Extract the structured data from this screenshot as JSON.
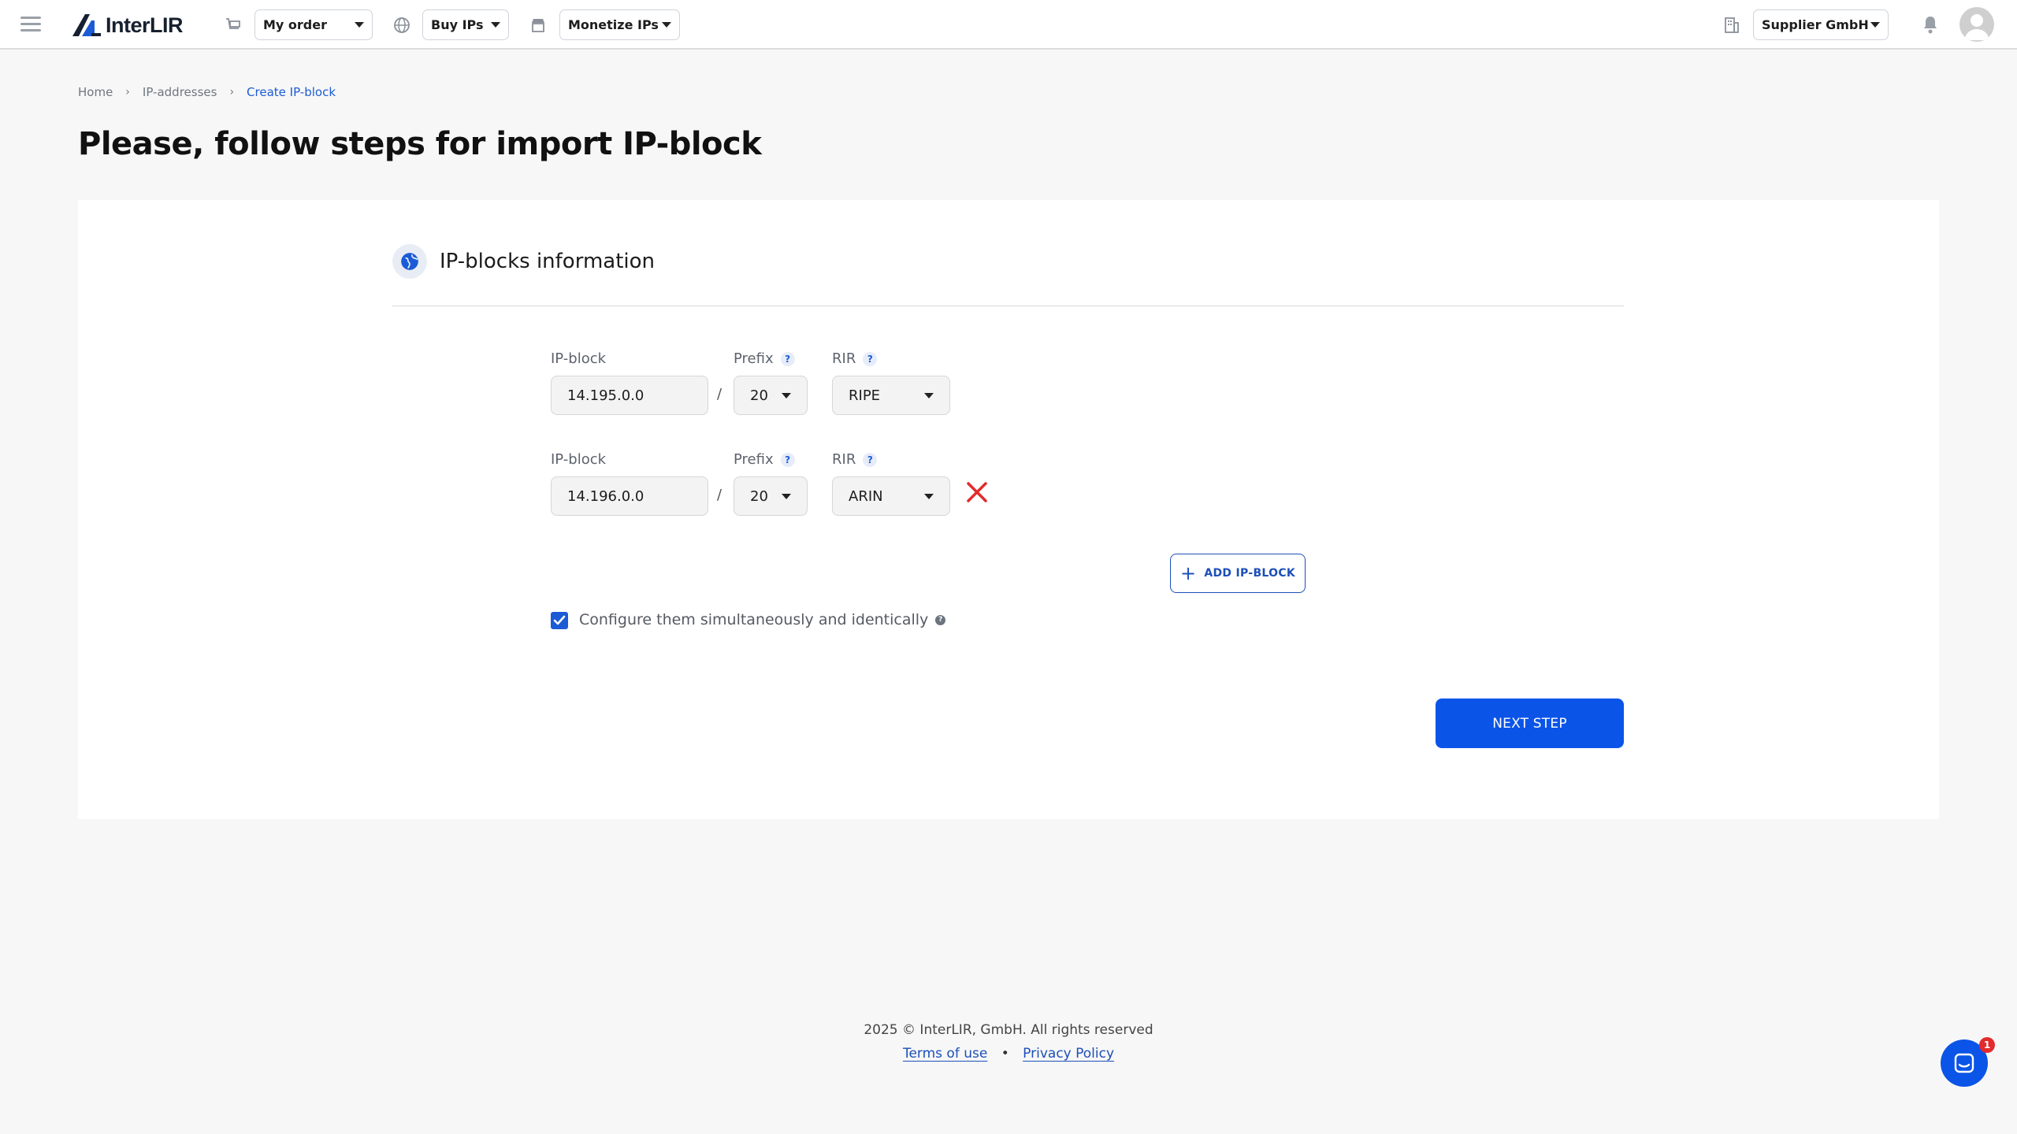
{
  "app": {
    "brand": "InterLIR"
  },
  "nav": {
    "my_order": "My order",
    "buy_ips": "Buy IPs",
    "monetize_ips": "Monetize IPs",
    "company": "Supplier GmbH"
  },
  "breadcrumb": [
    "Home",
    "IP-addresses",
    "Create IP-block"
  ],
  "page_title": "Please, follow steps for import IP-block",
  "section": {
    "title": "IP-blocks information"
  },
  "labels": {
    "ip_block": "IP-block",
    "prefix": "Prefix",
    "rir": "RIR",
    "help": "?"
  },
  "ip_blocks": [
    {
      "ip": "14.195.0.0",
      "prefix": "20",
      "rir": "RIPE"
    },
    {
      "ip": "14.196.0.0",
      "prefix": "20",
      "rir": "ARIN"
    }
  ],
  "separator": "/",
  "add_button": "ADD IP-BLOCK",
  "configure": {
    "label": "Configure them simultaneously and identically",
    "checked": true
  },
  "next_button": "NEXT STEP",
  "footer": {
    "copyright": "2025 © InterLIR, GmbH. All rights reserved",
    "terms": "Terms of use",
    "privacy": "Privacy Policy"
  },
  "chat": {
    "badge": "1"
  },
  "colors": {
    "primary": "#0b54e8",
    "accent": "#1c5bd6",
    "danger": "#e22b2b"
  }
}
